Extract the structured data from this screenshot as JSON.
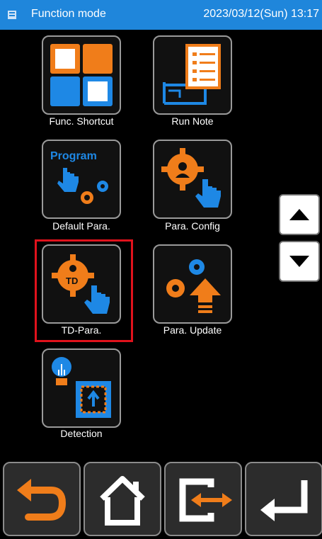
{
  "header": {
    "menu_icon": "menu-icon",
    "title": "Function mode",
    "datetime": "2023/03/12(Sun) 13:17"
  },
  "tiles": [
    {
      "label": "Func. Shortcut",
      "icon": "shortcut-grid-icon"
    },
    {
      "label": "Run Note",
      "icon": "run-note-icon"
    },
    {
      "label": "Default Para.",
      "icon": "program-default-icon",
      "icon_text": "Program"
    },
    {
      "label": "Para. Config",
      "icon": "parameter-config-icon"
    },
    {
      "label": "TD-Para.",
      "icon": "td-parameter-icon",
      "icon_text": "TD",
      "selected": true
    },
    {
      "label": "Para. Update",
      "icon": "parameter-update-icon"
    },
    {
      "label": "Detection",
      "icon": "detection-icon"
    }
  ],
  "scroll": {
    "up_icon": "arrow-up-icon",
    "down_icon": "arrow-down-icon"
  },
  "bottom_bar": [
    {
      "name": "back",
      "icon": "back-arrow-icon"
    },
    {
      "name": "home",
      "icon": "home-icon"
    },
    {
      "name": "switch",
      "icon": "switch-icon"
    },
    {
      "name": "enter",
      "icon": "enter-icon"
    }
  ],
  "colors": {
    "header_bg": "#1f86db",
    "orange": "#f07d1a",
    "blue": "#1e88e5",
    "selection": "#e0121c",
    "background": "#000000"
  }
}
